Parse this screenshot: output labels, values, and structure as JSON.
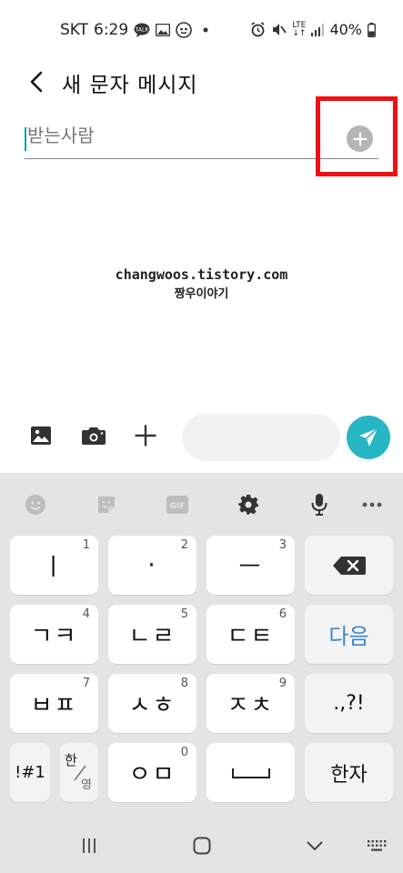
{
  "status_bar": {
    "carrier": "SKT",
    "time": "6:29",
    "network": "LTE",
    "battery": "40%"
  },
  "header": {
    "title": "새 문자 메시지"
  },
  "recipient": {
    "placeholder": "받는사람"
  },
  "watermark": {
    "line1": "changwoos.tistory.com",
    "line2": "짱우이야기"
  },
  "keyboard": {
    "keys": {
      "k1": {
        "label": "ㅣ",
        "num": "1"
      },
      "k2": {
        "label": "·",
        "num": "2"
      },
      "k3": {
        "label": "ㅡ",
        "num": "3"
      },
      "k4": {
        "label": "ㄱㅋ",
        "num": "4"
      },
      "k5": {
        "label": "ㄴㄹ",
        "num": "5"
      },
      "k6": {
        "label": "ㄷㅌ",
        "num": "6"
      },
      "k7": {
        "label": "ㅂㅍ",
        "num": "7"
      },
      "k8": {
        "label": "ㅅㅎ",
        "num": "8"
      },
      "k9": {
        "label": "ㅈㅊ",
        "num": "9"
      },
      "k0": {
        "label": "ㅇㅁ",
        "num": "0"
      }
    },
    "next_label": "다음",
    "punct_label": ".,?!",
    "symbols_label": "!#1",
    "lang_top": "한",
    "lang_bottom": "영",
    "hanja_label": "한자"
  },
  "colors": {
    "accent": "#27b6c4",
    "highlight": "#ee1111",
    "next_key": "#3b87c9"
  }
}
